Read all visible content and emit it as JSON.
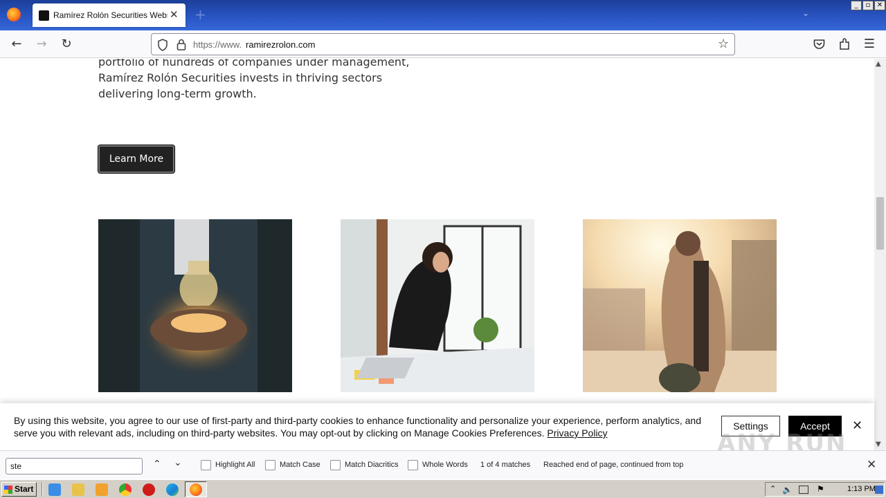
{
  "browser": {
    "tab_title": "Ramírez Rolón Securities Website |",
    "tab_close": "✕",
    "new_tab": "+",
    "url_protocol": "https://www.",
    "url_host": "ramirezrolon.com",
    "window_buttons": [
      "_",
      "▫",
      "✕"
    ]
  },
  "page": {
    "intro_lines": [
      "portfolio of hundreds of companies under management,",
      "Ramírez Rolón Securities invests in thriving sectors",
      "delivering long-term growth."
    ],
    "learn_more": "Learn More",
    "photos": [
      "lightbulb-hands-photo",
      "woman-at-laptop-photo",
      "man-walking-sunset-photo"
    ]
  },
  "cookie_banner": {
    "text": "By using this website, you agree to our use of first-party and third-party cookies to enhance functionality and personalize your experience, perform analytics, and serve you with relevant ads, including on third-party websites. You may opt-out by clicking on Manage Cookies Preferences.",
    "link": "Privacy Policy",
    "settings": "Settings",
    "accept": "Accept",
    "close": "✕",
    "watermark": "ANY RUN"
  },
  "find_bar": {
    "query": "ste",
    "highlight_all": "Highlight All",
    "match_case": "Match Case",
    "match_diacritics": "Match Diacritics",
    "whole_words": "Whole Words",
    "match_count": "1 of 4 matches",
    "status": "Reached end of page, continued from top",
    "close": "✕"
  },
  "taskbar": {
    "start": "Start",
    "clock": "1:13 PM"
  }
}
